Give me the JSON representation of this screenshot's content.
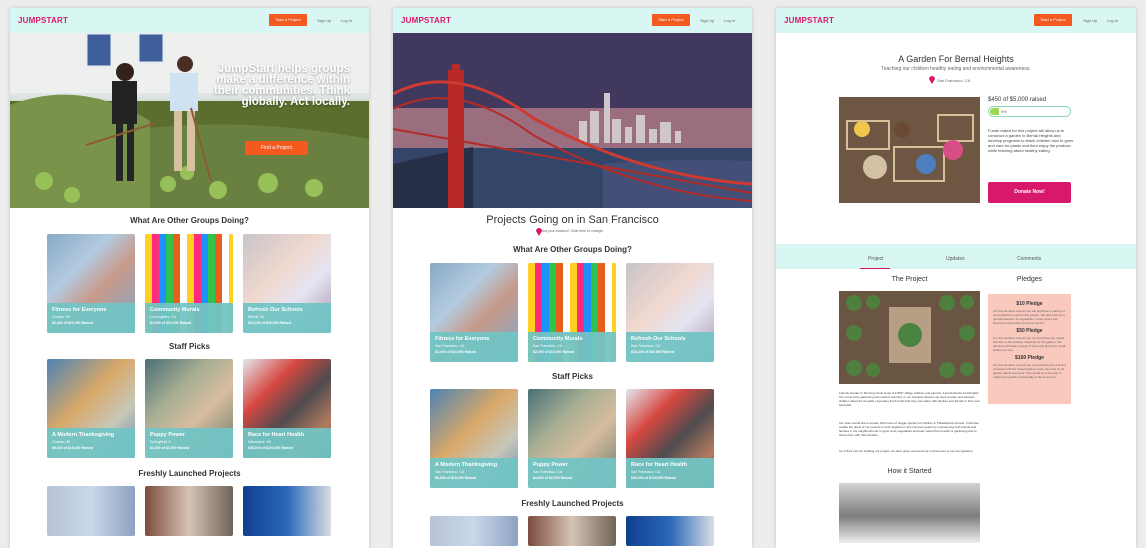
{
  "brand": {
    "logo": "JUMPSTART"
  },
  "nav": {
    "start": "Start a Project",
    "signup": "Sign Up",
    "login": "Log In"
  },
  "panel1": {
    "hero_text": "JumpStart helps groups make a difference within their communities. Think globally. Act locally.",
    "hero_button": "Find a Project",
    "sections": [
      "What Are Other Groups Doing?",
      "Staff Picks",
      "Freshly Launched Projects"
    ],
    "cards": [
      {
        "title": "Fitness for Everyone",
        "loc": "Omaha, NE",
        "funded": "$2,400 of $10,000 Raised"
      },
      {
        "title": "Community Murals",
        "loc": "Los Angeles, CA",
        "funded": "$2,000 of $10,000 Raised"
      },
      {
        "title": "Refresh Our Schools",
        "loc": "Detroit, MI",
        "funded": "$15,245 of $30,000 Raised"
      },
      {
        "title": "A Modern Thanksgiving",
        "loc": "Omaha, NE",
        "funded": "$6,000 of $15,000 Raised"
      },
      {
        "title": "Puppy Power",
        "loc": "Springfield, IL",
        "funded": "$4,000 of $2,000 Raised"
      },
      {
        "title": "Race for Heart Health",
        "loc": "Milwaukee, WI",
        "funded": "$35,000 of $100,000 Raised"
      }
    ]
  },
  "panel2": {
    "title": "Projects Going on in San Francisco",
    "location_note": "Not your location? Click here to change.",
    "sections": [
      "What Are Other Groups Doing?",
      "Staff Picks",
      "Freshly Launched Projects"
    ],
    "cards": [
      {
        "title": "Fitness for Everyone",
        "loc": "San Francisco, CA",
        "funded": "$2,400 of $10,000 Raised"
      },
      {
        "title": "Community Murals",
        "loc": "San Francisco, CA",
        "funded": "$2,000 of $10,000 Raised"
      },
      {
        "title": "Refresh Our Schools",
        "loc": "San Francisco, CA",
        "funded": "$15,245 of $30,000 Raised"
      },
      {
        "title": "A Modern Thanksgiving",
        "loc": "San Francisco, CA",
        "funded": "$6,000 of $15,000 Raised"
      },
      {
        "title": "Puppy Power",
        "loc": "San Francisco, CA",
        "funded": "$4,000 of $2,000 Raised"
      },
      {
        "title": "Race for Heart Health",
        "loc": "San Francisco, CA",
        "funded": "$35,000 of $100,000 Raised"
      }
    ]
  },
  "panel3": {
    "title": "A Garden For Bernal Heights",
    "tagline": "Teaching our children healthy eating and environmental awareness.",
    "location": "San Francisco, CA",
    "raised": "$450 of $5,000 raised",
    "percent": "9%",
    "description": "Funds raised for this project will allow us to construct a garden in Bernal Heights and develop programs to teach children how to grow and care for plants and then enjoy the produce while learning about healthy eating.",
    "donate": "Donate Now!",
    "tabs": [
      "Project",
      "Updates",
      "Comments"
    ],
    "project_heading": "The Project",
    "pledges_heading": "Pledges",
    "how_heading": "How it Started",
    "body_text_1": "Friends Garden in Morning Circle Hope is FIRST village children and parents. A Horticulturist and English, Our community gardening and outdoor learning. In our Gardens Spaces we want to learn and educate children about the benefits of growing fresh foods that they can share with families and friends in their own backyard.",
    "body_text_2": "Our team would like to donate 100 boxes of Veggie Garden kit children in Philadelphia schools. It will also enable the plans of our parents to work together in this common space by empowering both friends and families in the neighbourhood to grow more vegetables and learn about the benefits of gardening and to share them with their families.",
    "body_text_3": "As of their own for building our project, we have given seed and our environment to our own gardens.",
    "pledges": [
      {
        "title": "$10 Pledge",
        "text": "For this donation amount we will purchase a variety of seed packets to start in the garden. We also look for a special selection of vegetables, herbs, and a few flowers for decoration and pest control."
      },
      {
        "title": "$50 Pledge",
        "text": "For this donation amount we can purchase two raised bed kits or the building materials for the garden. We will also purchase a group of tools and gloves for small children to use."
      },
      {
        "title": "$100 Pledge",
        "text": "For this donation amount we can purchase the soil and compost to fill the raised beds to cover the area of our garden plants and plots. This would be a big step in making the garden sustainable in the long term."
      }
    ]
  }
}
